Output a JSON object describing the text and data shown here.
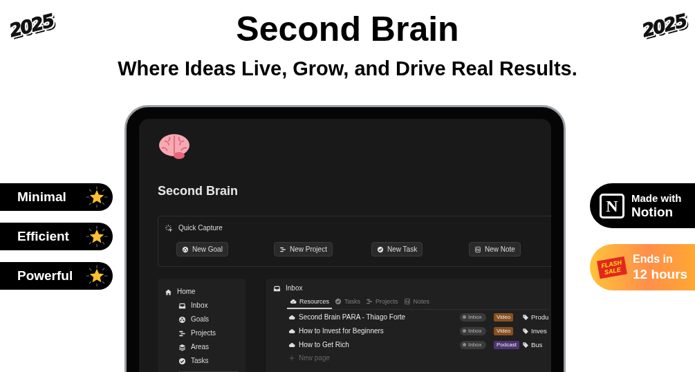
{
  "stickers": [
    {
      "text": "2025"
    },
    {
      "text": "2025"
    }
  ],
  "header": {
    "title": "Second Brain",
    "subtitle": "Where Ideas Live, Grow, and Drive Real Results."
  },
  "feature_pills": [
    {
      "label": "Minimal"
    },
    {
      "label": "Efficient"
    },
    {
      "label": "Powerful"
    }
  ],
  "badges": [
    {
      "kind": "notion",
      "logo_letter": "N",
      "line1": "Made with",
      "line2": "Notion"
    },
    {
      "kind": "sale",
      "ribbon": "FLASH SALE",
      "line1": "Ends in",
      "line2": "12 hours"
    }
  ],
  "tablet": {
    "page_title": "Second Brain",
    "quick_capture": {
      "title": "Quick Capture",
      "buttons": [
        {
          "label": "New Goal"
        },
        {
          "label": "New Project"
        },
        {
          "label": "New Task"
        },
        {
          "label": "New Note"
        }
      ]
    },
    "sidebar": {
      "items": [
        {
          "label": "Home",
          "children": [
            {
              "label": "Inbox"
            },
            {
              "label": "Goals"
            },
            {
              "label": "Projects"
            },
            {
              "label": "Areas"
            },
            {
              "label": "Tasks"
            }
          ]
        }
      ]
    },
    "inbox": {
      "title": "Inbox",
      "tabs": [
        {
          "label": "Resources",
          "selected": true
        },
        {
          "label": "Tasks",
          "selected": false
        },
        {
          "label": "Projects",
          "selected": false
        },
        {
          "label": "Notes",
          "selected": false
        }
      ],
      "rows": [
        {
          "title": "Second Brain PARA - Thiago Forte",
          "status": "Inbox",
          "type": {
            "label": "Video",
            "color": "#89511f"
          },
          "tag": "Produ"
        },
        {
          "title": "How to Invest for Beginners",
          "status": "Inbox",
          "type": {
            "label": "Video",
            "color": "#89511f"
          },
          "tag": "Inves"
        },
        {
          "title": "How to Get Rich",
          "status": "Inbox",
          "type": {
            "label": "Podcast",
            "color": "#4d3472"
          },
          "tag": "Bus"
        }
      ],
      "new_page": "New page"
    }
  }
}
